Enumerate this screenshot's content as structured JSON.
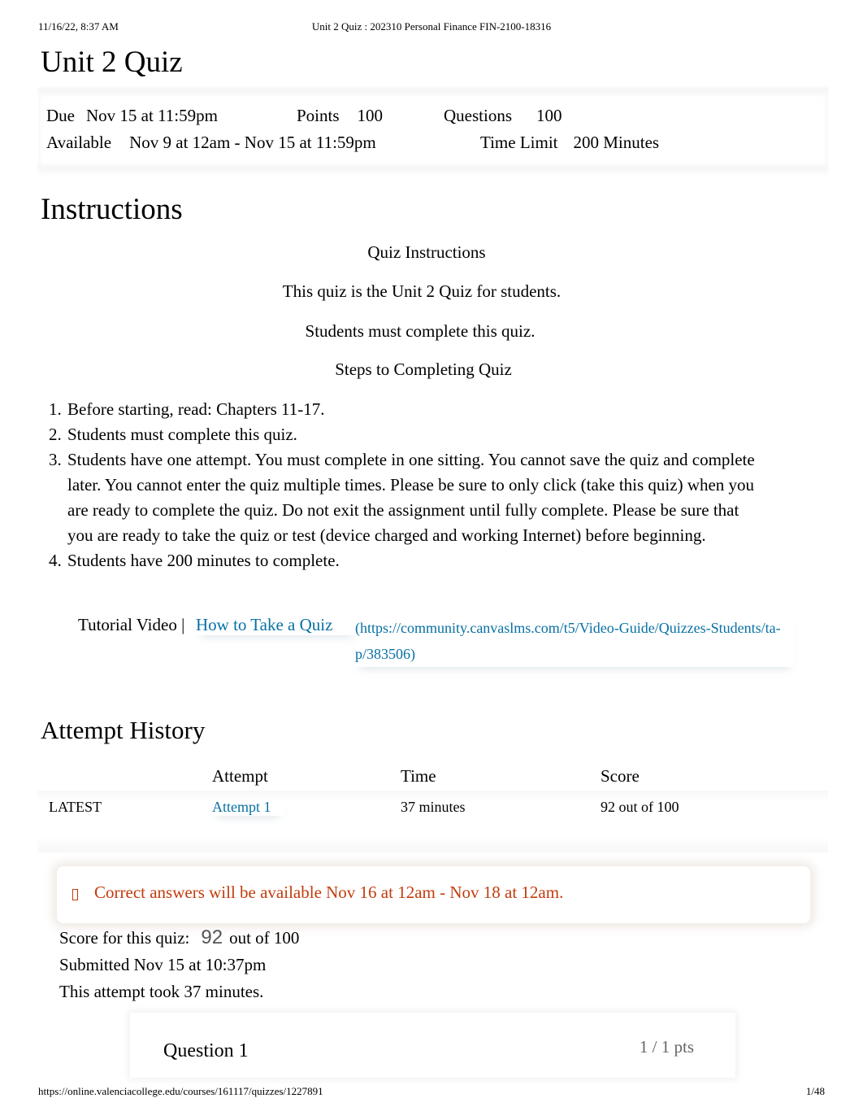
{
  "print_header": {
    "datetime": "11/16/22, 8:37 AM",
    "page_title": "Unit 2 Quiz : 202310 Personal Finance FIN-2100-18316"
  },
  "print_footer": {
    "url": "https://online.valenciacollege.edu/courses/161117/quizzes/1227891",
    "page_number": "1/48"
  },
  "quiz": {
    "title": "Unit 2 Quiz",
    "details": {
      "due_label": "Due",
      "due_value": "Nov 15 at 11:59pm",
      "points_label": "Points",
      "points_value": "100",
      "questions_label": "Questions",
      "questions_value": "100",
      "available_label": "Available",
      "available_value": "Nov 9 at 12am - Nov 15 at 11:59pm",
      "time_limit_label": "Time Limit",
      "time_limit_value": "200 Minutes"
    }
  },
  "instructions": {
    "heading": "Instructions",
    "subheading": "Quiz Instructions",
    "line1": "This quiz is the Unit 2 Quiz for students.",
    "line2": "Students must complete this quiz.",
    "steps_heading": "Steps to Completing Quiz",
    "steps": [
      {
        "num": "1.",
        "text": "Before starting, read: Chapters 11-17."
      },
      {
        "num": "2.",
        "text": "Students must complete this quiz."
      },
      {
        "num": "3.",
        "text": "Students have one attempt. You must complete in one sitting. You cannot save the quiz and complete later. You cannot enter the quiz multiple times. Please be sure to only click (take this quiz) when you are ready to complete the quiz. Do not exit the assignment until fully complete. Please be sure that you are ready to take the quiz or test (device charged and working Internet) before beginning."
      },
      {
        "num": "4.",
        "text": "Students have 200 minutes to complete."
      }
    ],
    "tutorial_label": "Tutorial Video |",
    "tutorial_link_text": "How to Take a Quiz",
    "tutorial_link_url": "(https://community.canvaslms.com/t5/Video-Guide/Quizzes-Students/ta-p/383506)"
  },
  "attempt_history": {
    "heading": "Attempt History",
    "columns": [
      "",
      "Attempt",
      "Time",
      "Score"
    ],
    "rows": [
      {
        "tag": "LATEST",
        "attempt": "Attempt 1",
        "time": "37 minutes",
        "score": "92 out of 100"
      }
    ]
  },
  "alert": {
    "icon": "info-icon",
    "text": "Correct answers will be available Nov 16 at 12am - Nov 18 at 12am.",
    "color": "#c23c0d"
  },
  "result": {
    "score_label": "Score for this quiz:",
    "score_value": "92",
    "score_suffix": "out of 100",
    "submitted": "Submitted Nov 15 at 10:37pm",
    "duration": "This attempt took 37 minutes."
  },
  "questions": [
    {
      "title": "Question 1",
      "points": "1 / 1 pts"
    }
  ],
  "colors": {
    "link": "#0770a3",
    "alert": "#c23c0d",
    "muted": "#666666"
  }
}
